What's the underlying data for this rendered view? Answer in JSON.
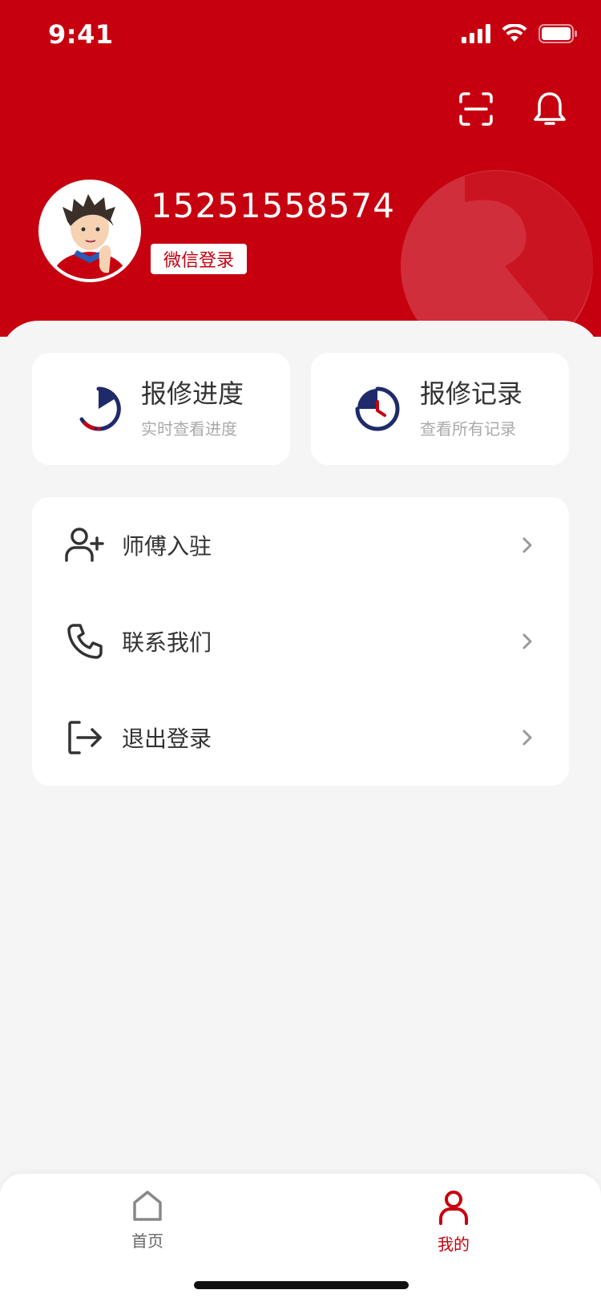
{
  "status_bar": {
    "time": "9:41"
  },
  "profile": {
    "phone": "15251558574",
    "wechat_login_label": "微信登录"
  },
  "quick_cards": [
    {
      "title": "报修进度",
      "subtitle": "实时查看进度",
      "icon": "progress-icon"
    },
    {
      "title": "报修记录",
      "subtitle": "查看所有记录",
      "icon": "clock-record-icon"
    }
  ],
  "menu": [
    {
      "label": "师傅入驻",
      "icon": "add-user-icon"
    },
    {
      "label": "联系我们",
      "icon": "phone-icon"
    },
    {
      "label": "退出登录",
      "icon": "logout-icon"
    }
  ],
  "tabbar": {
    "home_label": "首页",
    "mine_label": "我的"
  },
  "colors": {
    "brand_red": "#c6000f",
    "navy": "#1f2a6b",
    "background": "#f5f5f5"
  }
}
